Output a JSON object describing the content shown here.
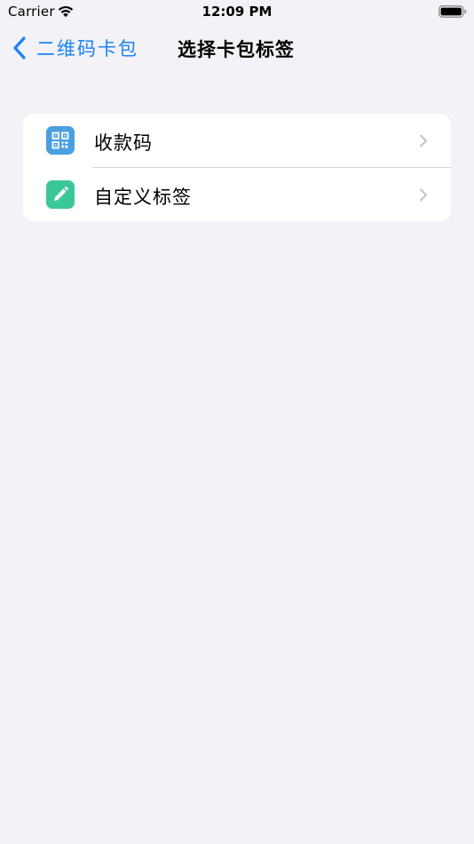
{
  "status_bar": {
    "carrier": "Carrier",
    "time": "12:09 PM",
    "wifi_icon": "wifi-icon",
    "battery_icon": "battery-icon"
  },
  "nav": {
    "back_label": "二维码卡包",
    "title": "选择卡包标签",
    "back_icon": "chevron-left-icon"
  },
  "list": {
    "items": [
      {
        "label": "收款码",
        "icon": "qr-code-icon",
        "icon_color": "#4a9fe0"
      },
      {
        "label": "自定义标签",
        "icon": "pencil-icon",
        "icon_color": "#3cc79b"
      }
    ],
    "disclosure_icon": "chevron-right-icon"
  },
  "colors": {
    "background": "#f2f2f7",
    "accent": "#1a82f7",
    "card": "#ffffff",
    "separator": "#d6d6da"
  }
}
